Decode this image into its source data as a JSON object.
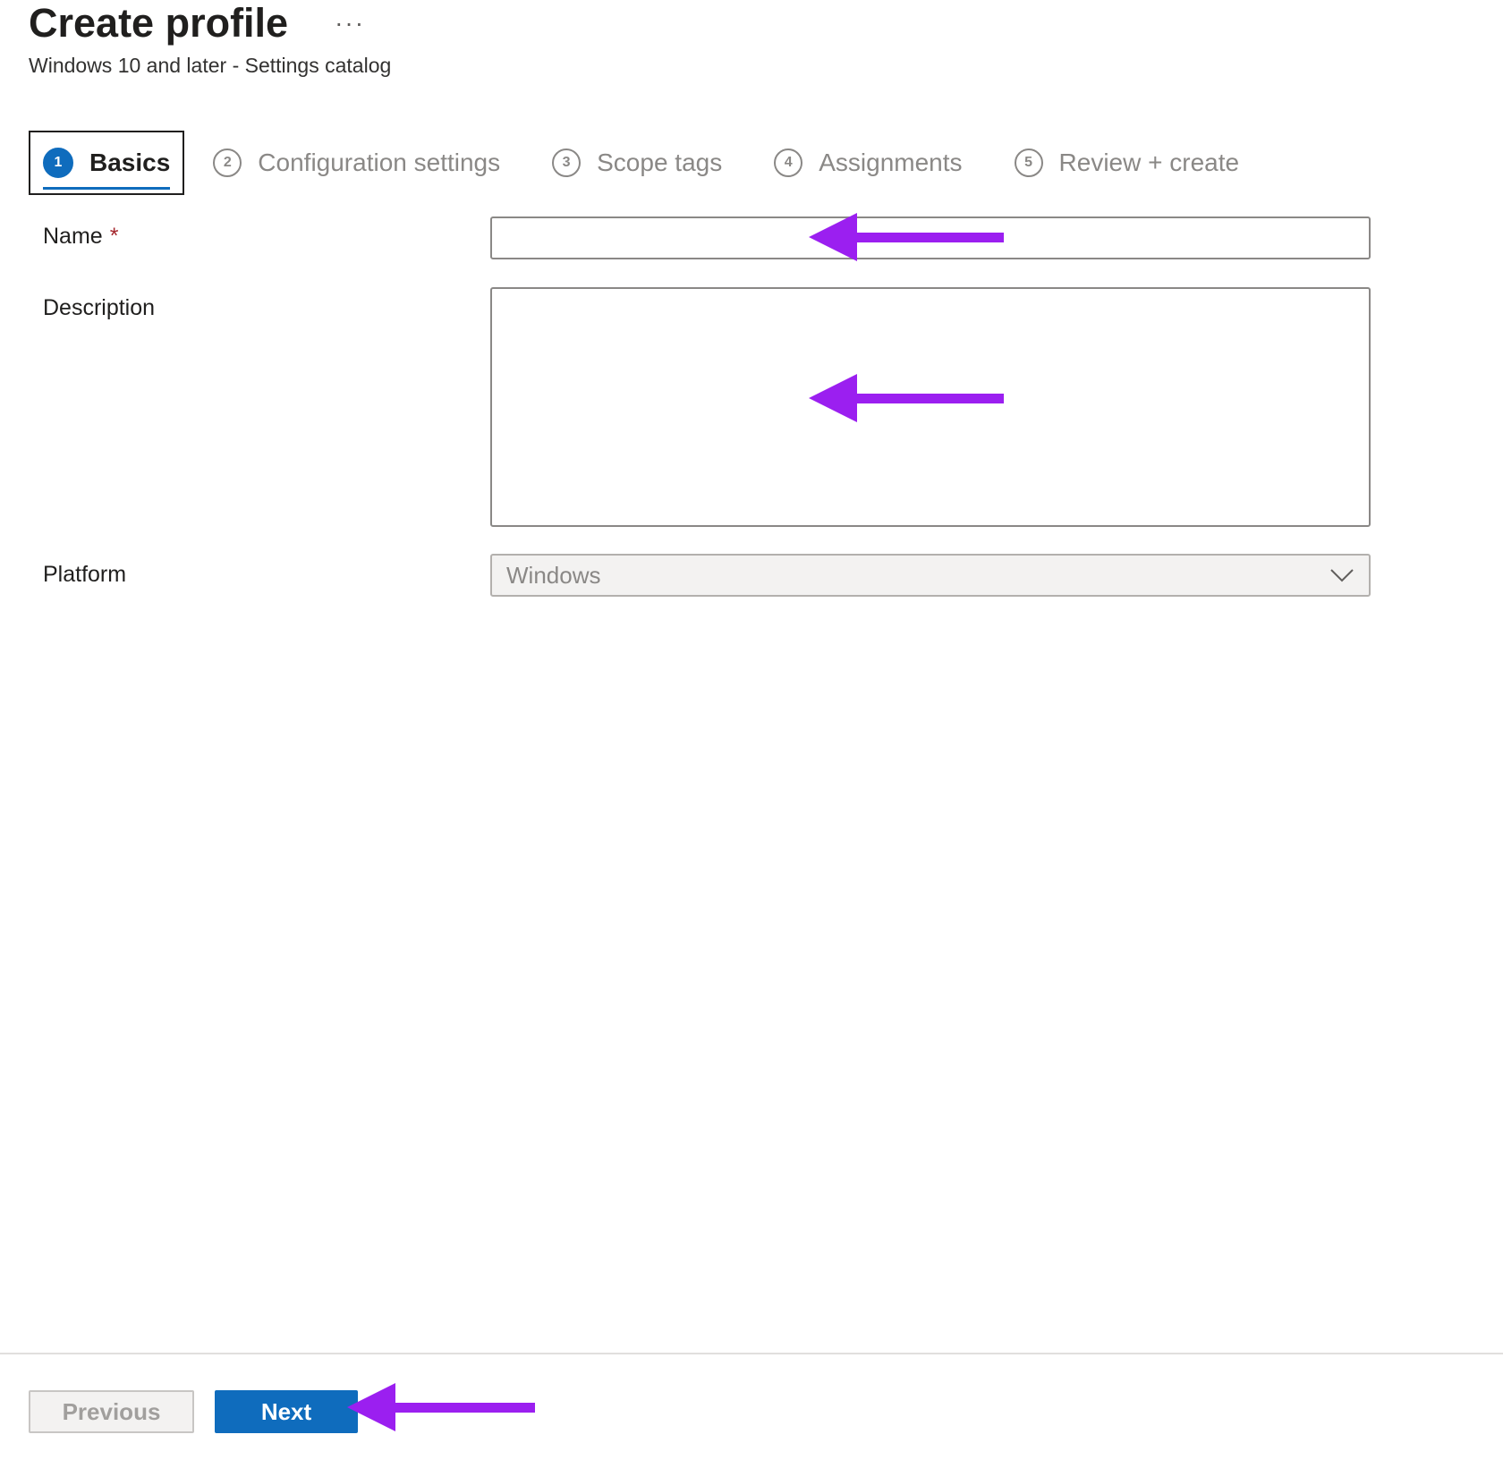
{
  "header": {
    "title": "Create profile",
    "more_label": "···",
    "subtitle": "Windows 10 and later - Settings catalog"
  },
  "steps": [
    {
      "num": "1",
      "label": "Basics",
      "active": true
    },
    {
      "num": "2",
      "label": "Configuration settings"
    },
    {
      "num": "3",
      "label": "Scope tags"
    },
    {
      "num": "4",
      "label": "Assignments"
    },
    {
      "num": "5",
      "label": "Review + create"
    }
  ],
  "form": {
    "name_label": "Name",
    "required_mark": "*",
    "name_value": "",
    "description_label": "Description",
    "description_value": "",
    "platform_label": "Platform",
    "platform_value": "Windows"
  },
  "footer": {
    "previous_label": "Previous",
    "next_label": "Next"
  },
  "colors": {
    "accent": "#0f6cbd",
    "annotation_arrow": "#9b1ff0",
    "required": "#a4262c"
  }
}
